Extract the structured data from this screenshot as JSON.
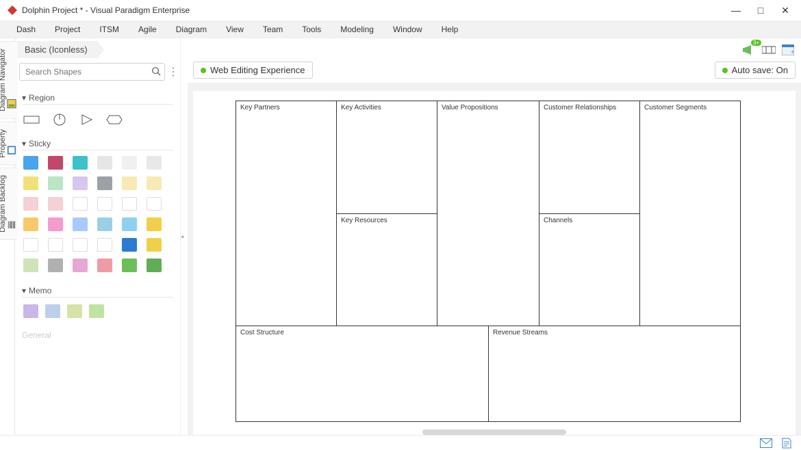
{
  "title": "Dolphin Project * - Visual Paradigm Enterprise",
  "menubar": [
    "Dash",
    "Project",
    "ITSM",
    "Agile",
    "Diagram",
    "View",
    "Team",
    "Tools",
    "Modeling",
    "Window",
    "Help"
  ],
  "vtabs": [
    "Diagram Navigator",
    "Property",
    "Diagram Backlog"
  ],
  "crumb": "Basic (Iconless)",
  "search": {
    "placeholder": "Search Shapes"
  },
  "palette": {
    "region_label": "Region",
    "sticky_label": "Sticky",
    "memo_label": "Memo",
    "general_label": "General",
    "sticky_colors": [
      "#4aa3ef",
      "#c3466b",
      "#3cc2c8",
      "#e6e6e6",
      "#f0f0f0",
      "#e8e8e8",
      "#f0e07a",
      "#b9e6c3",
      "#d6c6f0",
      "#9aa2a8",
      "#f7eab2",
      "#f7eab2",
      "#f3d1d6",
      "#f3d1d6",
      "#ffffff",
      "#ffffff",
      "#ffffff",
      "#ffffff",
      "#f7c96b",
      "#f49bd0",
      "#a9c8ff",
      "#9ad0e6",
      "#8fd0f0",
      "#f2cf4a",
      "#ffffff",
      "#ffffff",
      "#ffffff",
      "#ffffff",
      "#2a7bd1",
      "#f2cf4a",
      "#cfe3b8",
      "#b0b0b0",
      "#e7a7d4",
      "#f09aa8",
      "#6bbf59",
      "#5fae55"
    ],
    "memo_colors": [
      "#c9b7e8",
      "#bcd0ec",
      "#d7e2a8",
      "#bfe3a0"
    ]
  },
  "tab": {
    "label": "Web Editing Experience"
  },
  "autosave": "Auto save: On",
  "canvas": {
    "cells": {
      "key_partners": "Key Partners",
      "key_activities": "Key Activities",
      "key_resources": "Key Resources",
      "value_propositions": "Value Propositions",
      "customer_relationships": "Customer Relationships",
      "channels": "Channels",
      "customer_segments": "Customer Segments",
      "cost_structure": "Cost Structure",
      "revenue_streams": "Revenue Streams"
    }
  },
  "toolbar_badge": "3+"
}
